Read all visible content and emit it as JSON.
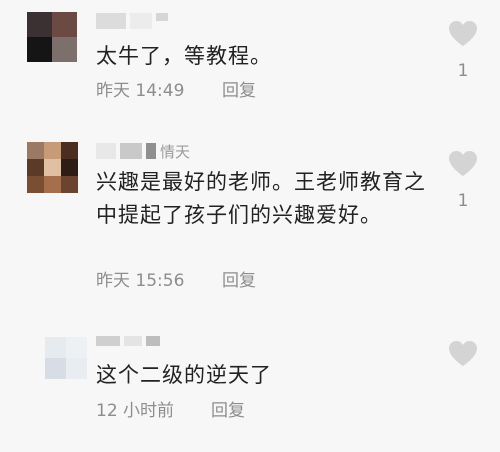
{
  "colors": {
    "background": "#f7f7f7",
    "text": "#222222",
    "meta": "#8d8d8d",
    "heart": "#d4d4d4"
  },
  "comments": [
    {
      "username_visible": "",
      "text": "太牛了，等教程。",
      "time": "昨天 14:49",
      "reply_label": "回复",
      "likes": "1",
      "avatar_icon": "pixelated-avatar-dark"
    },
    {
      "username_visible": "情天",
      "text": "兴趣是最好的老师。王老师教育之中提起了孩子们的兴趣爱好。",
      "time": "昨天 15:56",
      "reply_label": "回复",
      "likes": "1",
      "avatar_icon": "pixelated-avatar-brown"
    },
    {
      "username_visible": "",
      "text": "这个二级的逆天了",
      "time": "12 小时前",
      "reply_label": "回复",
      "likes": "",
      "avatar_icon": "pixelated-avatar-light"
    }
  ]
}
